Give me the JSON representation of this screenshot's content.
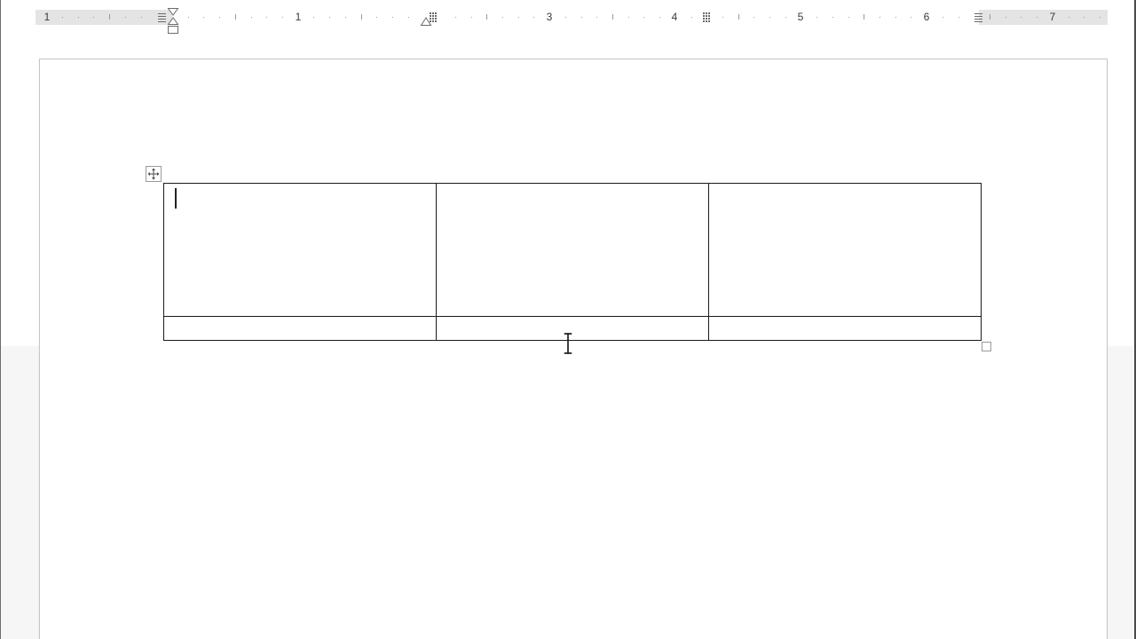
{
  "ruler": {
    "labels": [
      "1",
      "1",
      "3",
      "4",
      "5",
      "6",
      "7"
    ],
    "background_color": "#e4e4e4",
    "text_area_color": "#ffffff"
  },
  "page": {
    "background_color": "#ffffff"
  },
  "table": {
    "rows": [
      [
        "",
        "",
        ""
      ],
      [
        "",
        "",
        ""
      ]
    ],
    "border_color": "#1a1a1a"
  },
  "icons": {
    "table_move": "move-arrows-icon",
    "table_resize": "resize-square-icon",
    "mouse_cursor": "ibeam-cursor-icon",
    "first_line_indent": "first-line-indent-icon",
    "hanging_indent": "hanging-indent-icon",
    "left_indent": "left-indent-icon",
    "right_indent": "right-indent-icon",
    "column_marker": "column-marker-icon"
  }
}
